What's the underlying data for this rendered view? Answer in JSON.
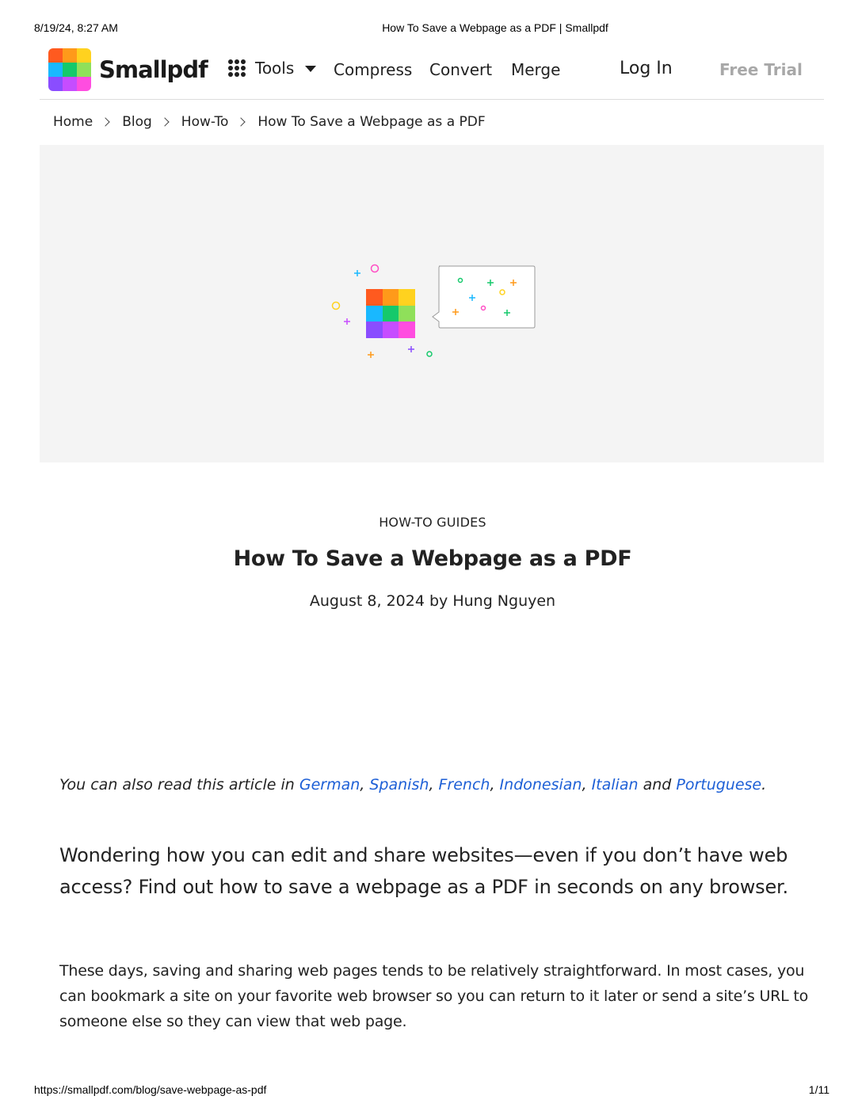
{
  "print_header": {
    "datetime": "8/19/24, 8:27 AM",
    "doc_title": "How To Save a Webpage as a PDF | Smallpdf"
  },
  "print_footer": {
    "url": "https://smallpdf.com/blog/save-webpage-as-pdf",
    "page": "1/11"
  },
  "nav": {
    "brand": "Smallpdf",
    "tools_label": "Tools",
    "links": [
      "Compress",
      "Convert",
      "Merge"
    ],
    "login_label": "Log In",
    "trial_label": "Free Trial"
  },
  "logo_colors": [
    "#ff5a1f",
    "#ff9a1a",
    "#ffd21f",
    "#19b8ff",
    "#15c96b",
    "#8fe05a",
    "#8a4dff",
    "#c64dff",
    "#ff4de0"
  ],
  "breadcrumb": [
    "Home",
    "Blog",
    "How-To",
    "How To Save a Webpage as a PDF"
  ],
  "article": {
    "category": "HOW-TO GUIDES",
    "title": "How To Save a Webpage as a PDF",
    "byline": "August 8, 2024 by Hung Nguyen",
    "lang_intro": "You can also read this article in ",
    "languages": [
      "German",
      "Spanish",
      "French",
      "Indonesian",
      "Italian",
      "Portuguese"
    ],
    "lang_and": " and ",
    "lang_end": ".",
    "lead": "Wondering how you can edit and share websites—even if you don’t have web access? Find out how to save a webpage as a PDF in seconds on any browser.",
    "body": "These days, saving and sharing web pages tends to be relatively straightforward. In most cases, you can bookmark a site on your favorite web browser so you can return to it later or send a site’s URL to someone else so they can view that web page."
  },
  "colors": {
    "link": "#1d5fd6",
    "hero_bg": "#f4f4f4",
    "trial_text": "#a8a8a8"
  }
}
